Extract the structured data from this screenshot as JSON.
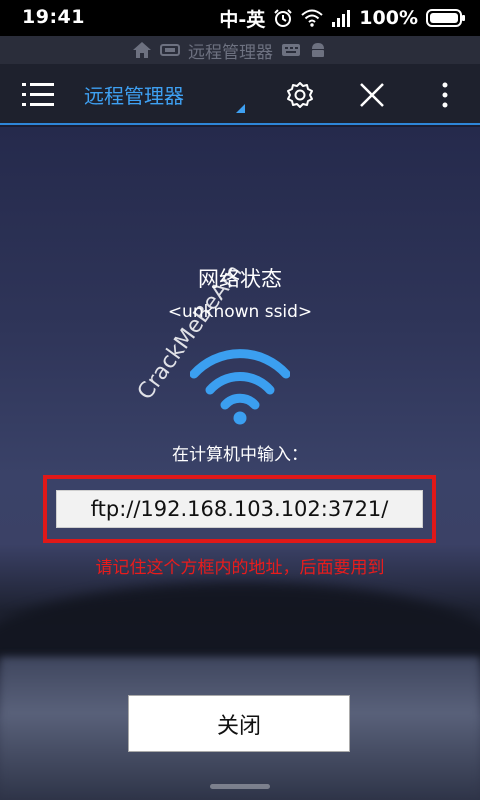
{
  "status_bar": {
    "time": "19:41",
    "carrier": "中-英",
    "battery": "100%"
  },
  "notification_row": {
    "app_label": "远程管理器"
  },
  "toolbar": {
    "title": "远程管理器"
  },
  "dialog": {
    "network_title": "网络状态",
    "ssid": "<unknown ssid>",
    "instruction": "在计算机中输入：",
    "ftp_address": "ftp://192.168.103.102:3721/",
    "annotation": "请记住这个方框内的地址，后面要用到",
    "close_label": "关闭"
  },
  "watermark": "CrackMeBeAm",
  "colors": {
    "accent": "#3ea0f2",
    "wifi": "#3b9ff0",
    "highlight": "#e01818"
  }
}
